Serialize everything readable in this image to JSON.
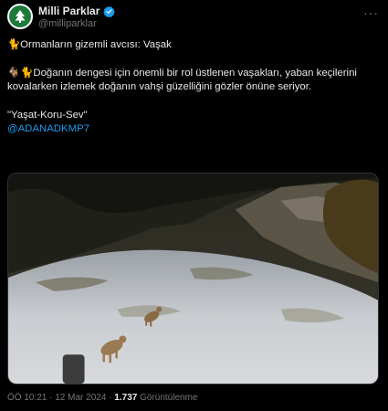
{
  "account": {
    "name": "Milli Parklar",
    "handle": "@milliparklar",
    "more_label": "···"
  },
  "tweet": {
    "line1": "🐈Ormanların gizemli avcısı: Vaşak",
    "line2": "🐐🐈Doğanın dengesi için önemli bir rol üstlenen vaşakları, yaban keçilerini kovalarken izlemek doğanın vahşi güzelliğini gözler önüne seriyor.",
    "line3": "\"Yaşat-Koru-Sev\"",
    "mention": "@ADANADKMP7"
  },
  "media": {
    "description_icon": "trail-camera-photo"
  },
  "meta": {
    "time": "ÖÖ 10:21",
    "sep1": " · ",
    "date": "12 Mar 2024",
    "sep2": " · ",
    "views": "1.737",
    "views_label": " Görüntülenme"
  },
  "colors": {
    "accent": "#1d9bf0",
    "text": "#e7e9ea",
    "muted": "#71767b",
    "background": "#000000"
  }
}
